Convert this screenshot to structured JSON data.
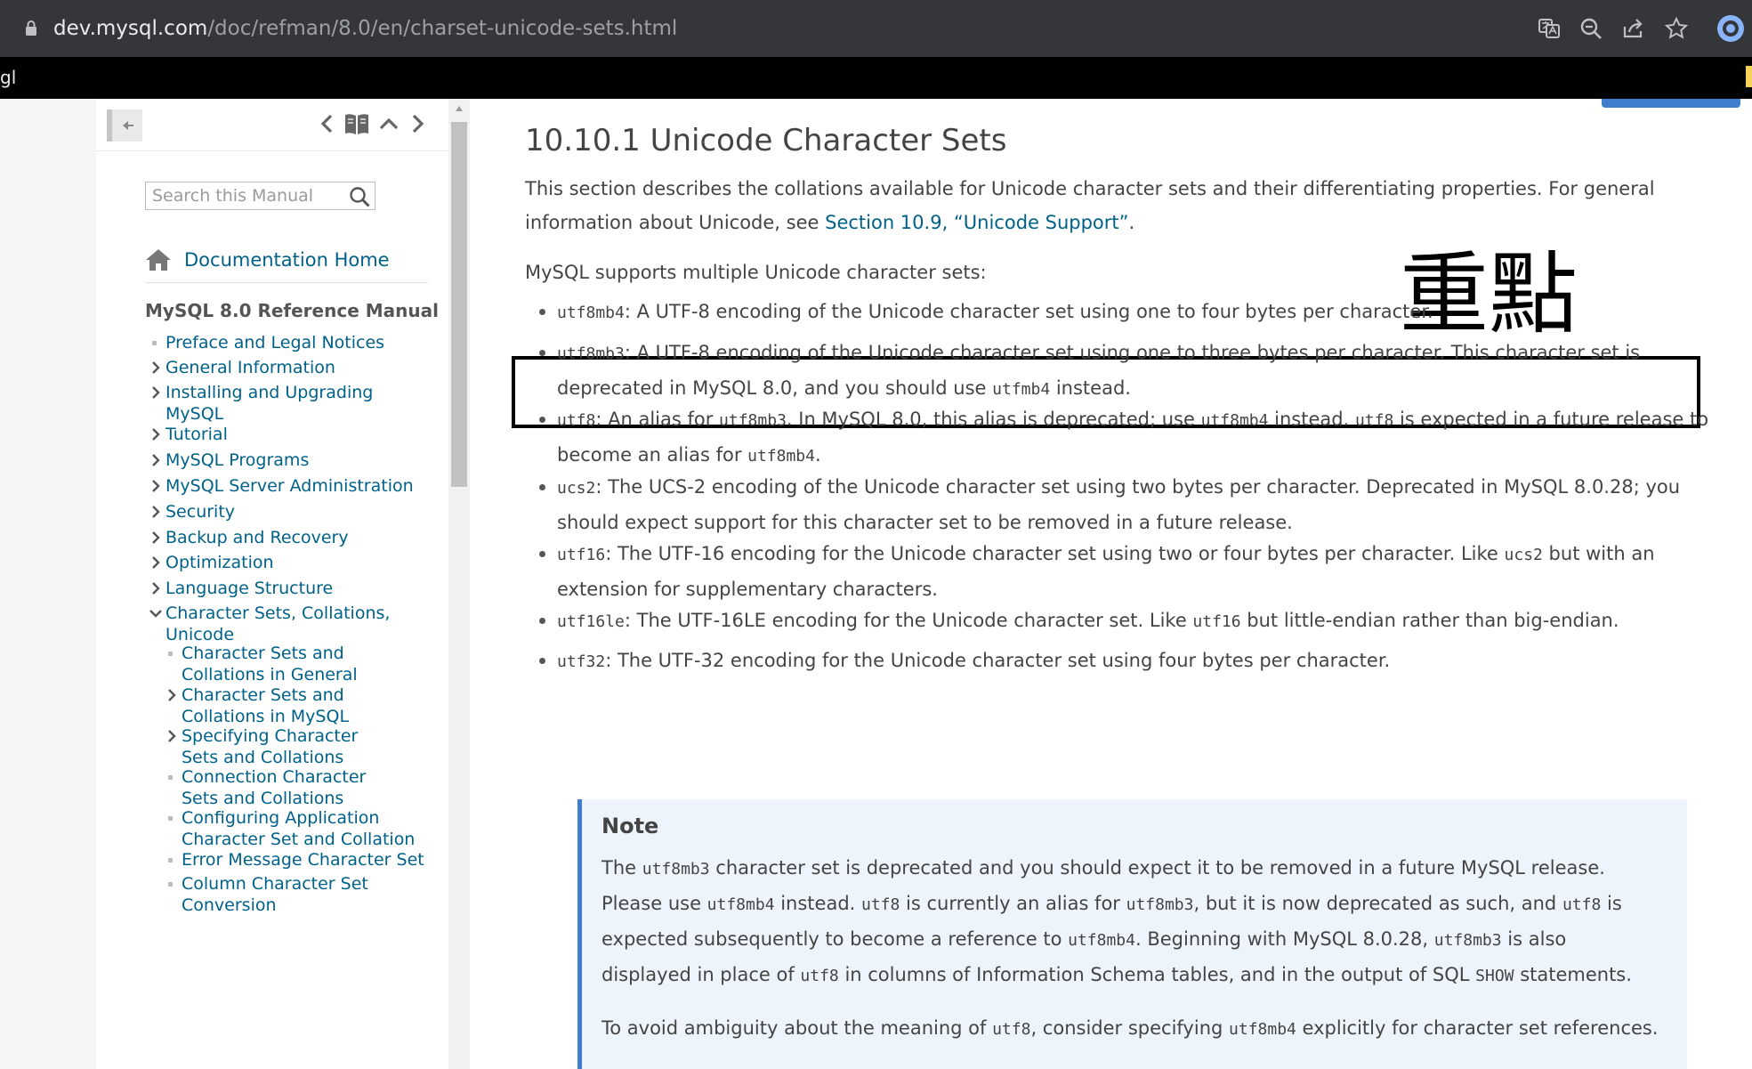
{
  "browser": {
    "url_host": "dev.mysql.com",
    "url_path": "/doc/refman/8.0/en/charset-unicode-sets.html",
    "bookmark_fragment": "gl"
  },
  "sidebar": {
    "search_placeholder": "Search this Manual",
    "doc_home": "Documentation Home",
    "manual_title": "MySQL 8.0 Reference Manual",
    "items": [
      {
        "label": "Preface and Legal Notices",
        "marker": "bullet"
      },
      {
        "label": "General Information",
        "marker": "chevron-right"
      },
      {
        "label": "Installing and Upgrading MySQL",
        "marker": "chevron-right"
      },
      {
        "label": "Tutorial",
        "marker": "chevron-right"
      },
      {
        "label": "MySQL Programs",
        "marker": "chevron-right"
      },
      {
        "label": "MySQL Server Administration",
        "marker": "chevron-right"
      },
      {
        "label": "Security",
        "marker": "chevron-right"
      },
      {
        "label": "Backup and Recovery",
        "marker": "chevron-right"
      },
      {
        "label": "Optimization",
        "marker": "chevron-right"
      },
      {
        "label": "Language Structure",
        "marker": "chevron-right"
      },
      {
        "label": "Character Sets, Collations, Unicode",
        "marker": "chevron-down"
      }
    ],
    "subitems": [
      {
        "label": "Character Sets and Collations in General",
        "marker": "bullet"
      },
      {
        "label": "Character Sets and Collations in MySQL",
        "marker": "chevron-right"
      },
      {
        "label": "Specifying Character Sets and Collations",
        "marker": "chevron-right"
      },
      {
        "label": "Connection Character Sets and Collations",
        "marker": "bullet"
      },
      {
        "label": "Configuring Application Character Set and Collation",
        "marker": "bullet"
      },
      {
        "label": "Error Message Character Set",
        "marker": "bullet"
      },
      {
        "label": "Column Character Set Conversion",
        "marker": "bullet"
      }
    ]
  },
  "main": {
    "title": "10.10.1 Unicode Character Sets",
    "intro_1": "This section describes the collations available for Unicode character sets and their differentiating properties. For general information about Unicode, see ",
    "intro_link": "Section 10.9, “Unicode Support”",
    "intro_2": ".",
    "supports": "MySQL supports multiple Unicode character sets:",
    "annotation": "重點",
    "items": {
      "utf8mb4": {
        "code": "utf8mb4",
        "text": ": A UTF-8 encoding of the Unicode character set using one to four bytes per character."
      },
      "utf8mb3": {
        "code": "utf8mb3",
        "text": ": A UTF-8 encoding of the Unicode character set using one to three bytes per character. This character set is deprecated in MySQL 8.0, and you should use ",
        "code2": "utfmb4",
        "text2": " instead."
      },
      "utf8": {
        "code": "utf8",
        "t1": ": An alias for ",
        "c1": "utf8mb3",
        "t2": ". In MySQL 8.0, this alias is deprecated; use ",
        "c2": "utf8mb4",
        "t3": " instead. ",
        "c3": "utf8",
        "t4": " is expected in a future release to become an alias for ",
        "c4": "utf8mb4",
        "t5": "."
      },
      "ucs2": {
        "code": "ucs2",
        "text": ": The UCS-2 encoding of the Unicode character set using two bytes per character. Deprecated in MySQL 8.0.28; you should expect support for this character set to be removed in a future release."
      },
      "utf16": {
        "code": "utf16",
        "t1": ": The UTF-16 encoding for the Unicode character set using two or four bytes per character. Like ",
        "c1": "ucs2",
        "t2": " but with an extension for supplementary characters."
      },
      "utf16le": {
        "code": "utf16le",
        "t1": ": The UTF-16LE encoding for the Unicode character set. Like ",
        "c1": "utf16",
        "t2": " but little-endian rather than big-endian."
      },
      "utf32": {
        "code": "utf32",
        "text": ": The UTF-32 encoding for the Unicode character set using four bytes per character."
      }
    },
    "note": {
      "title": "Note",
      "p1": {
        "t1": "The ",
        "c1": "utf8mb3",
        "t2": " character set is deprecated and you should expect it to be removed in a future MySQL release. Please use ",
        "c2": "utf8mb4",
        "t3": " instead. ",
        "c3": "utf8",
        "t4": " is currently an alias for ",
        "c4": "utf8mb3",
        "t5": ", but it is now deprecated as such, and ",
        "c5": "utf8",
        "t6": " is expected subsequently to become a reference to ",
        "c6": "utf8mb4",
        "t7": ". Beginning with MySQL 8.0.28, ",
        "c7": "utf8mb3",
        "t8": " is also displayed in place of ",
        "c8": "utf8",
        "t9": " in columns of Information Schema tables, and in the output of SQL ",
        "c9": "SHOW",
        "t10": " statements."
      },
      "p2": {
        "t1": "To avoid ambiguity about the meaning of ",
        "c1": "utf8",
        "t2": ", consider specifying ",
        "c2": "utf8mb4",
        "t3": " explicitly for character set references."
      }
    }
  }
}
